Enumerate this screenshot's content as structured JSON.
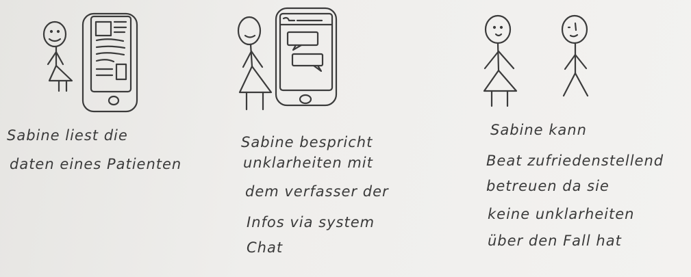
{
  "panels": [
    {
      "lines": [
        "Sabine liest die",
        "daten eines Patienten"
      ]
    },
    {
      "lines": [
        "Sabine bespricht",
        "unklarheiten mit",
        "dem verfasser der",
        "Infos via system",
        "Chat"
      ]
    },
    {
      "lines": [
        "Sabine kann",
        "Beat zufriedenstellend",
        "betreuen da sie",
        "keine unklarheiten",
        "über den Fall hat"
      ]
    }
  ]
}
